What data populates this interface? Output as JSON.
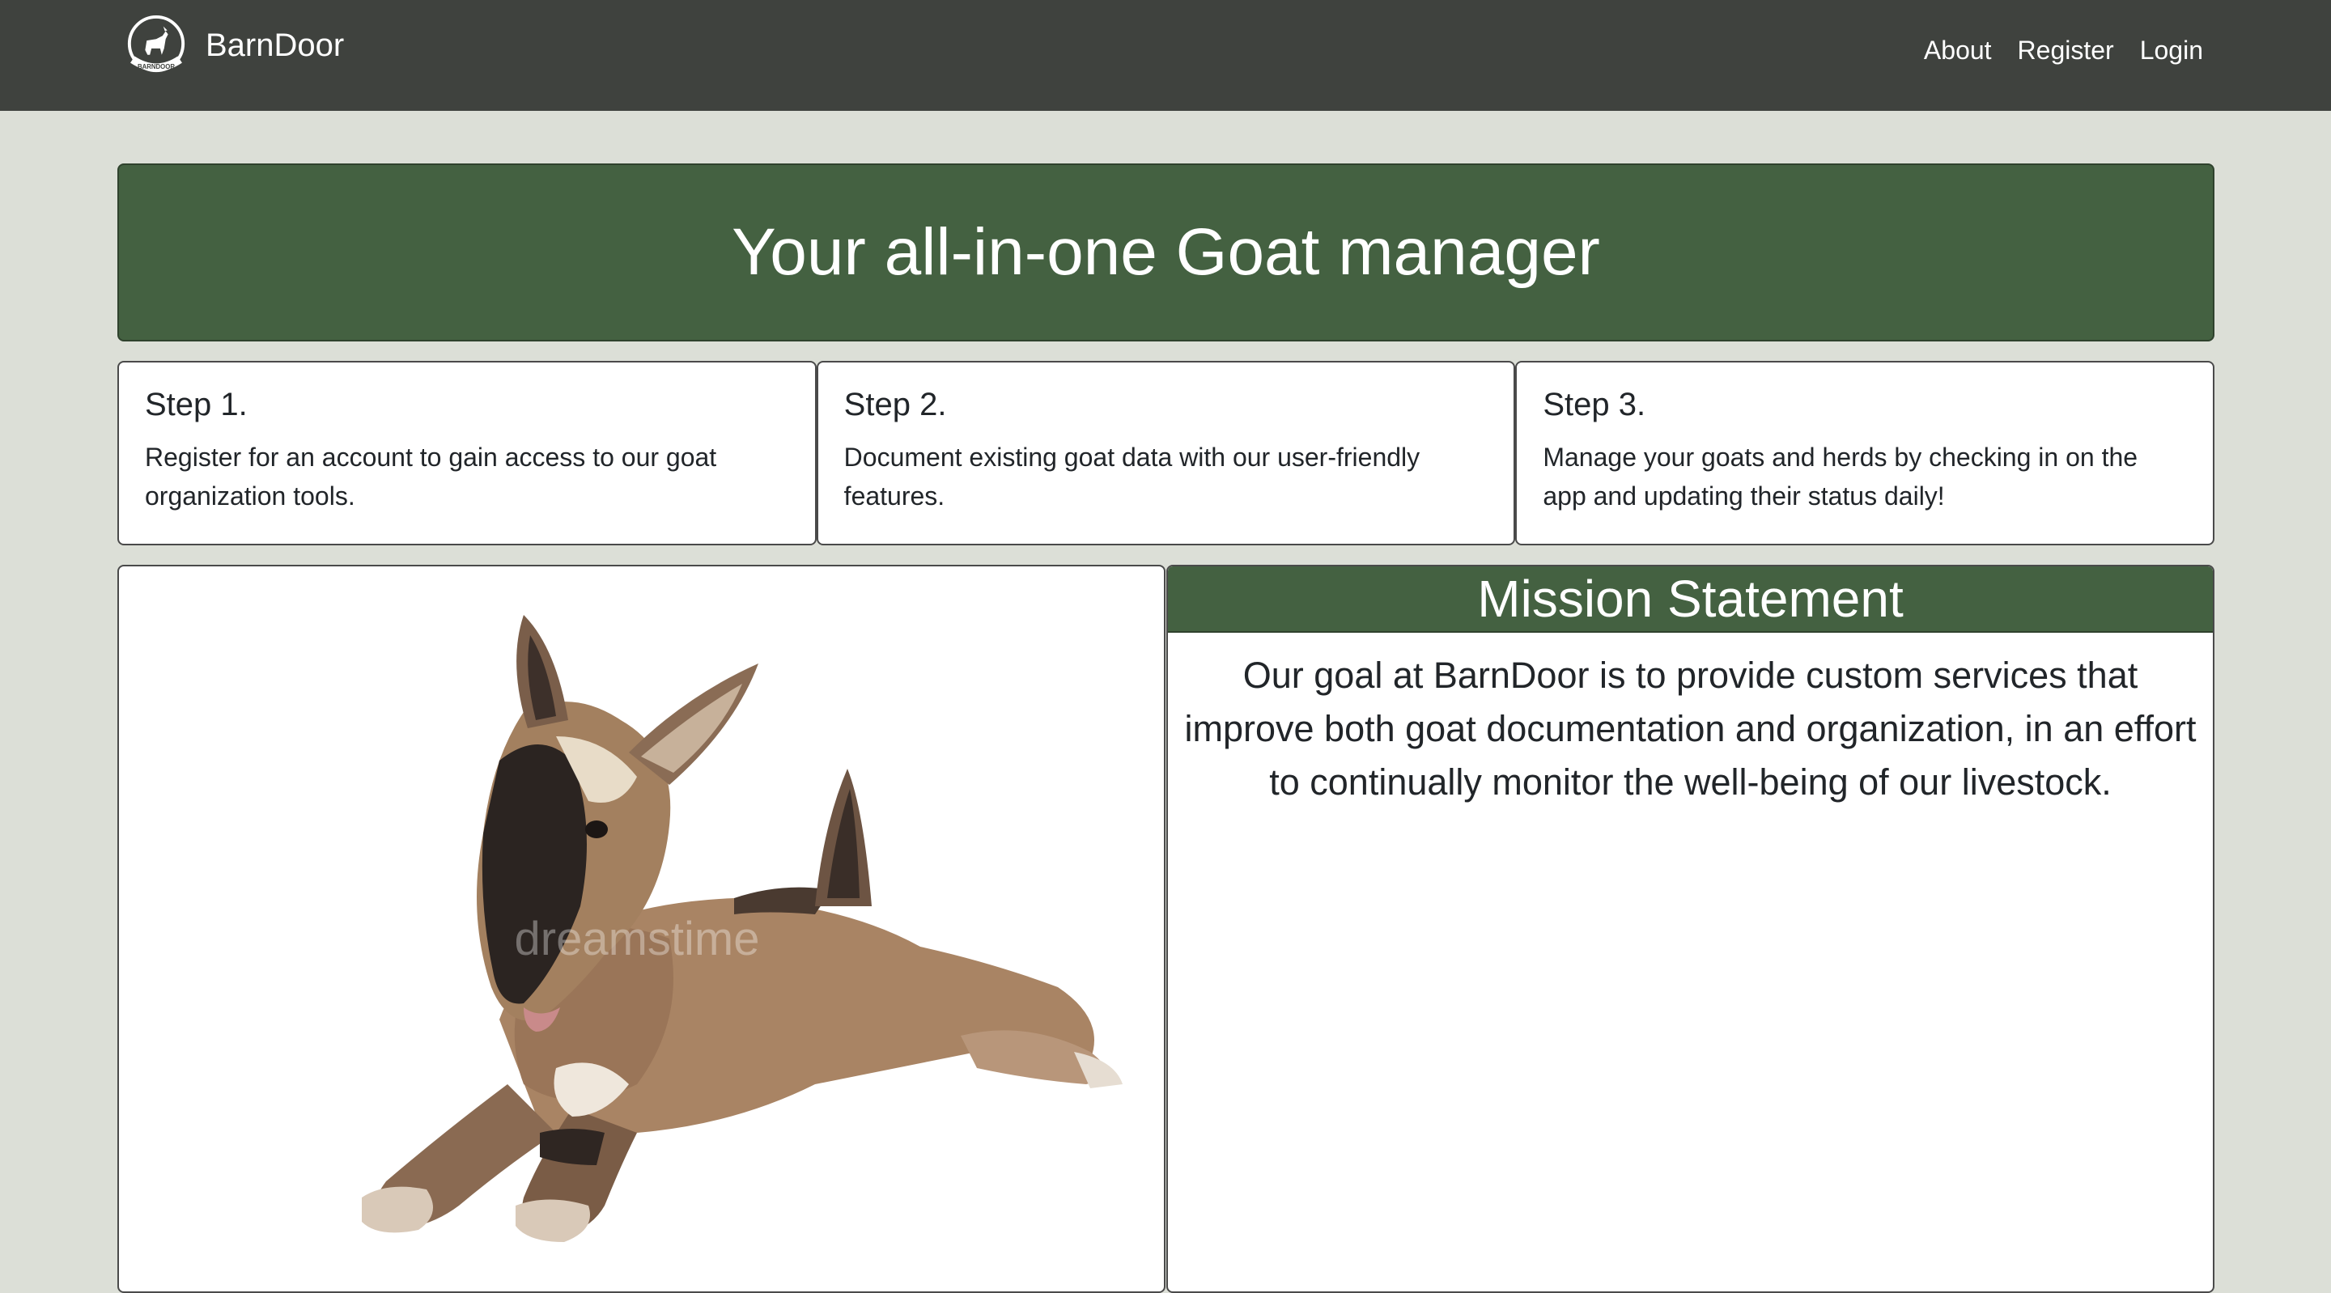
{
  "nav": {
    "brand": "BarnDoor",
    "logo_text": "BARNDOOR",
    "links": [
      {
        "label": "About"
      },
      {
        "label": "Register"
      },
      {
        "label": "Login"
      }
    ]
  },
  "hero": {
    "title": "Your all-in-one Goat manager"
  },
  "steps": [
    {
      "title": "Step 1.",
      "text": "Register for an account to gain access to our goat organization tools."
    },
    {
      "title": "Step 2.",
      "text": "Document existing goat data with our user-friendly features."
    },
    {
      "title": "Step 3.",
      "text": "Manage your goats and herds by checking in on the app and updating their status daily!"
    }
  ],
  "image": {
    "watermark": "dreamstime"
  },
  "mission": {
    "title": "Mission Statement",
    "text": "Our goal at BarnDoor is to provide custom services that improve both goat documentation and organization, in an effort to continually monitor the well-being of our livestock."
  },
  "colors": {
    "navbar": "#3f423e",
    "accent_green": "#446141",
    "page_background": "#dcdfd7"
  }
}
